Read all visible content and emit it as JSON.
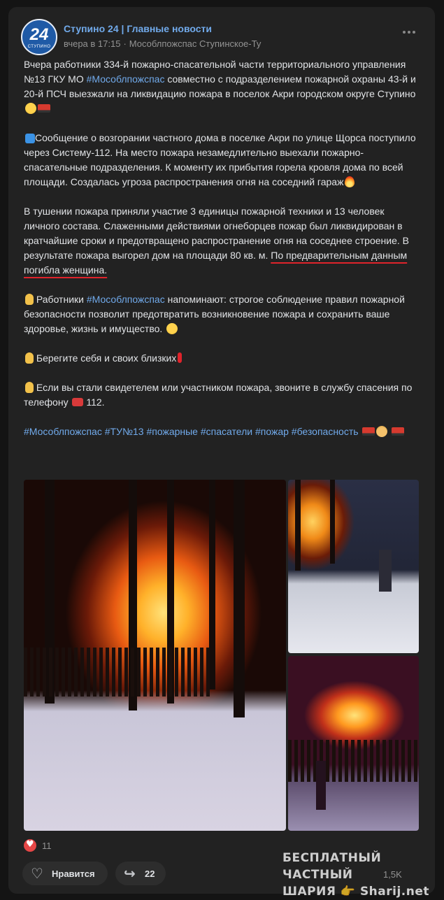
{
  "post": {
    "group_name": "Ступино 24 | Главные новости",
    "avatar_text": "24",
    "avatar_sub": "СТУПИНО",
    "time": "вчера в 17:15",
    "dot": "·",
    "source": "Мособлпожспас Ступинское-Ту",
    "paragraphs": {
      "p1_a": "Вчера работники 334-й пожарно-спасательной части территориального управления №13 ГКУ МО ",
      "p1_tag": "#Мособлпожспас",
      "p1_b": " совместно с подразделением пожарной охраны 43-й и 20-й ПСЧ выезжали на ликвидацию пожара в поселок Акри городском округе Ступино",
      "p2": "Сообщение о возгорании частного дома в поселке Акри по улице Щорса поступило через Систему-112. На место пожара незамедлительно выехали пожарно-спасательные подразделения. К моменту их прибытия горела кровля дома по всей площади. Создалась угроза распространения огня на соседний гараж",
      "p3_a": "В тушении пожара приняли участие 3 единицы пожарной техники и 13 человек личного состава. Слаженными действиями огнеборцев пожар был ликвидирован в кратчайшие сроки и предотвращено распространение огня на соседнее строение. В результате пожара выгорел дом на площади 80 кв. м. ",
      "p3_b": "По предварительным данным погибла женщина.",
      "p4_a": "Работники ",
      "p4_tag": "#Мособлпожспас",
      "p4_b": " напоминают: строгое соблюдение правил пожарной безопасности позволит предотвратить возникновение пожара и сохранить ваше здоровье, жизнь и имущество.",
      "p5": " Берегите себя и своих близких",
      "p6": "Если вы стали свидетелем или участником пожара, звоните в службу спасения по телефону",
      "p6_num": " 112."
    },
    "hashtags": [
      "#Мособлпожспас",
      "#ТУ№13",
      "#пожарные",
      "#спасатели",
      "#пожар",
      "#безопасность"
    ],
    "likes_count": "11",
    "like_label": "Нравится",
    "shares_count": "22",
    "views": "1,5K"
  },
  "icons": {
    "more": "more-horizontal-icon",
    "heart": "heart-icon",
    "share": "share-icon",
    "views": "eye-icon"
  },
  "watermark": {
    "line1": "БЕСПЛАТНЫЙ ЧАСТНЫЙ",
    "line2": "ШАРИЯ 👉 Sharij.net"
  },
  "colors": {
    "background": "#141414",
    "card": "#222222",
    "link": "#71aaeb",
    "text": "#e1e3e6",
    "muted": "#939393",
    "underline": "#e0232b",
    "like": "#e64646"
  }
}
